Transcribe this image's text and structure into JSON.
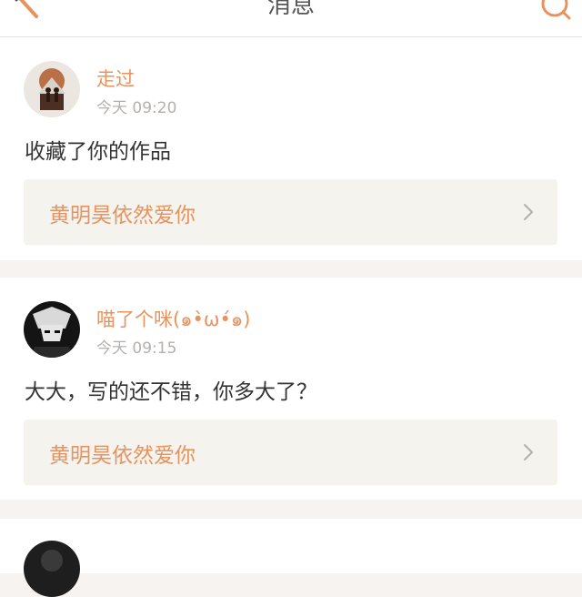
{
  "header": {
    "title": "消息",
    "back_icon": "back-arrow-icon",
    "search_icon": "search-icon"
  },
  "colors": {
    "accent": "#e8935e",
    "text": "#333333",
    "muted": "#b3b0ad",
    "ref_bg": "#f4f3ee",
    "page_bg": "#f6f3f1"
  },
  "messages": [
    {
      "username": "走过",
      "time": "今天 09:20",
      "text": "收藏了你的作品",
      "work_title": "黄明昊依然爱你"
    },
    {
      "username": "喵了个咪(๑•̀ω•́๑)",
      "time": "今天 09:15",
      "text": "大大，写的还不错，你多大了？",
      "work_title": "黄明昊依然爱你"
    },
    {
      "username": "",
      "time": "",
      "text": "",
      "work_title": ""
    }
  ]
}
